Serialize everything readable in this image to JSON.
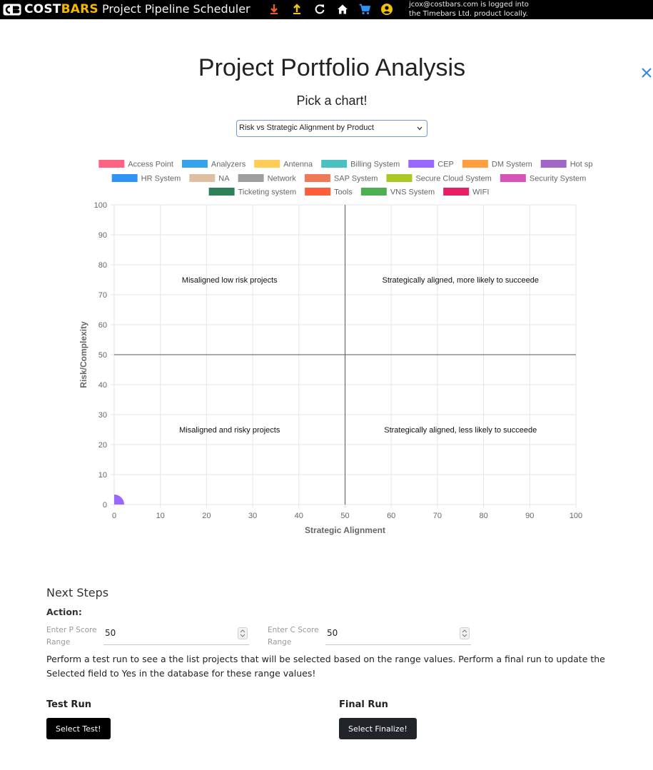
{
  "navbar": {
    "brand_cost": "COST",
    "brand_bars": "BARS",
    "app_title": "Project Pipeline Scheduler",
    "icons": [
      "download-icon",
      "upload-icon",
      "refresh-icon",
      "home-icon",
      "cart-icon",
      "account-icon"
    ],
    "user_line1": "jcox@costbars.com is logged into",
    "user_line2": "the Timebars Ltd. product locally."
  },
  "page": {
    "title": "Project Portfolio Analysis",
    "subtitle": "Pick a chart!",
    "close_icon": "close-icon"
  },
  "chart_select": {
    "selected": "Risk vs Strategic Alignment by Product"
  },
  "chart_data": {
    "type": "scatter",
    "xlabel": "Strategic Alignment",
    "ylabel": "Risk/Complexity",
    "xlim": [
      0,
      100
    ],
    "ylim": [
      0,
      100
    ],
    "x_ticks": [
      0,
      10,
      20,
      30,
      40,
      50,
      60,
      70,
      80,
      90,
      100
    ],
    "y_ticks": [
      0,
      10,
      20,
      30,
      40,
      50,
      60,
      70,
      80,
      90,
      100
    ],
    "grid": true,
    "legend_position": "top",
    "quadrant_lines": {
      "x": 50,
      "y": 50
    },
    "annotations": [
      {
        "text": "Misaligned low risk projects",
        "x": 25,
        "y": 75
      },
      {
        "text": "Strategically aligned, more likely to succeede",
        "x": 75,
        "y": 75
      },
      {
        "text": "Misaligned and risky projects",
        "x": 25,
        "y": 25
      },
      {
        "text": "Strategically aligned, less likely to succeede",
        "x": 75,
        "y": 25
      }
    ],
    "series": [
      {
        "name": "Access Point",
        "color": "#ff6384",
        "points": []
      },
      {
        "name": "Analyzers",
        "color": "#36a2eb",
        "points": []
      },
      {
        "name": "Antenna",
        "color": "#ffcd56",
        "points": []
      },
      {
        "name": "Billing System",
        "color": "#4bc0c0",
        "points": []
      },
      {
        "name": "CEP",
        "color": "#9966ff",
        "points": [
          {
            "x": 0,
            "y": 0
          }
        ]
      },
      {
        "name": "DM System",
        "color": "#ff9f40",
        "points": []
      },
      {
        "name": "Hot spot",
        "color": "#a066c8",
        "points": []
      },
      {
        "name": "HR System",
        "color": "#2e93f5",
        "points": []
      },
      {
        "name": "NA",
        "color": "#dfbfa2",
        "points": []
      },
      {
        "name": "Network",
        "color": "#9e9e9e",
        "points": []
      },
      {
        "name": "SAP System",
        "color": "#ef7a57",
        "points": []
      },
      {
        "name": "Secure Cloud System",
        "color": "#a9c823",
        "points": []
      },
      {
        "name": "Security System",
        "color": "#d752b9",
        "points": []
      },
      {
        "name": "Ticketing system",
        "color": "#2e8058",
        "points": []
      },
      {
        "name": "Tools",
        "color": "#ff5c3a",
        "points": []
      },
      {
        "name": "VNS System",
        "color": "#4caf50",
        "points": []
      },
      {
        "name": "WIFI",
        "color": "#e91e63",
        "points": []
      }
    ]
  },
  "next_steps": {
    "title": "Next Steps",
    "action_label": "Action:",
    "p_label_line1": "Enter P Score",
    "p_label_line2": "Range",
    "p_value": "50",
    "c_label_line1": "Enter C Score",
    "c_label_line2": "Range",
    "c_value": "50",
    "description": "Perform a test run to see a the list projects that will be selected based on the range values. Perform a final run to update the Selected field to Yes in the database for these range values!",
    "test_title": "Test Run",
    "test_button": "Select Test!",
    "final_title": "Final Run",
    "final_button": "Select Finalize!"
  }
}
